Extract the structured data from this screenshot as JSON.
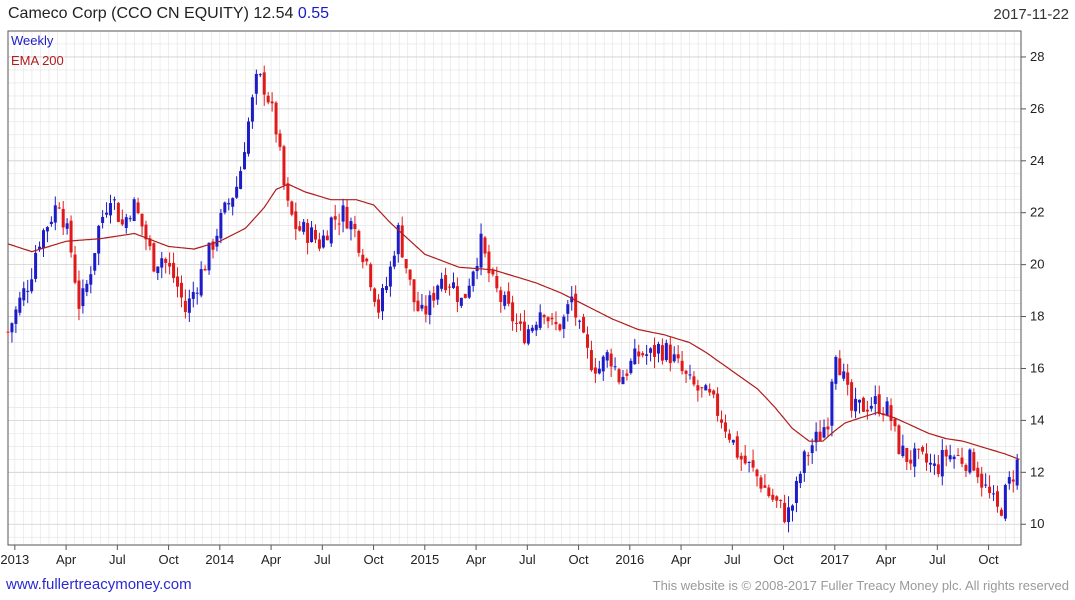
{
  "header": {
    "title": "Cameco Corp (CCO CN EQUITY)",
    "price": "12.54",
    "change": "0.55",
    "date": "2017-11-22"
  },
  "footer": {
    "website": "www.fullertreacymoney.com",
    "copyright": "This website is © 2008-2017 Fuller Treacy Money plc. All rights reserved"
  },
  "colors": {
    "up": "#1c1cc8",
    "down": "#e01a1a",
    "ema": "#b01c1c",
    "grid": "#e2e2e2",
    "frame": "#555555"
  },
  "chart_data": {
    "type": "candlestick",
    "legend": [
      {
        "label": "Weekly",
        "color": "#1c1cc8"
      },
      {
        "label": "EMA 200",
        "color": "#b01c1c"
      }
    ],
    "ylim": [
      9.2,
      29.0
    ],
    "y_ticks": [
      10,
      12,
      14,
      16,
      18,
      20,
      22,
      24,
      26,
      28
    ],
    "x_ticks": [
      {
        "label": "2013",
        "month": 0
      },
      {
        "label": "Apr",
        "month": 3
      },
      {
        "label": "Jul",
        "month": 6
      },
      {
        "label": "Oct",
        "month": 9
      },
      {
        "label": "2014",
        "month": 12
      },
      {
        "label": "Apr",
        "month": 15
      },
      {
        "label": "Jul",
        "month": 18
      },
      {
        "label": "Oct",
        "month": 21
      },
      {
        "label": "2015",
        "month": 24
      },
      {
        "label": "Apr",
        "month": 27
      },
      {
        "label": "Jul",
        "month": 30
      },
      {
        "label": "Oct",
        "month": 33
      },
      {
        "label": "2016",
        "month": 36
      },
      {
        "label": "Apr",
        "month": 39
      },
      {
        "label": "Jul",
        "month": 42
      },
      {
        "label": "Oct",
        "month": 45
      },
      {
        "label": "2017",
        "month": 48
      },
      {
        "label": "Apr",
        "month": 51
      },
      {
        "label": "Jul",
        "month": 54
      },
      {
        "label": "Oct",
        "month": 57
      }
    ],
    "x_range_months": [
      -0.4,
      58.9
    ],
    "close_keypoints": [
      [
        -0.4,
        17.4
      ],
      [
        0.3,
        18.6
      ],
      [
        0.9,
        19.5
      ],
      [
        1.3,
        20.8
      ],
      [
        2.0,
        21.7
      ],
      [
        2.6,
        22.5
      ],
      [
        3.3,
        20.5
      ],
      [
        3.8,
        18.3
      ],
      [
        4.3,
        19.4
      ],
      [
        4.9,
        21.4
      ],
      [
        5.6,
        22.8
      ],
      [
        6.3,
        21.5
      ],
      [
        6.9,
        22.4
      ],
      [
        7.5,
        21.4
      ],
      [
        8.1,
        20.1
      ],
      [
        8.6,
        20.3
      ],
      [
        9.4,
        19.4
      ],
      [
        10.0,
        18.2
      ],
      [
        10.6,
        19.2
      ],
      [
        11.3,
        20.3
      ],
      [
        12.0,
        21.6
      ],
      [
        12.6,
        22.5
      ],
      [
        13.1,
        23.2
      ],
      [
        13.5,
        24.9
      ],
      [
        14.2,
        27.2
      ],
      [
        14.7,
        26.8
      ],
      [
        15.3,
        25.2
      ],
      [
        15.9,
        22.3
      ],
      [
        16.5,
        21.4
      ],
      [
        17.3,
        21.2
      ],
      [
        17.9,
        20.8
      ],
      [
        18.5,
        21.7
      ],
      [
        19.3,
        22.0
      ],
      [
        19.9,
        21.3
      ],
      [
        20.6,
        20.1
      ],
      [
        21.3,
        18.3
      ],
      [
        21.9,
        19.5
      ],
      [
        22.4,
        21.4
      ],
      [
        22.8,
        20.3
      ],
      [
        23.3,
        18.7
      ],
      [
        23.8,
        18.0
      ],
      [
        24.3,
        18.5
      ],
      [
        24.9,
        19.6
      ],
      [
        25.6,
        19.3
      ],
      [
        26.2,
        18.5
      ],
      [
        26.8,
        19.9
      ],
      [
        27.3,
        20.8
      ],
      [
        27.9,
        19.3
      ],
      [
        28.5,
        18.6
      ],
      [
        29.1,
        18.0
      ],
      [
        29.7,
        17.3
      ],
      [
        30.3,
        17.7
      ],
      [
        30.9,
        18.5
      ],
      [
        31.5,
        17.5
      ],
      [
        32.1,
        17.8
      ],
      [
        32.6,
        18.7
      ],
      [
        33.1,
        17.3
      ],
      [
        33.6,
        16.4
      ],
      [
        34.2,
        16.0
      ],
      [
        34.8,
        16.6
      ],
      [
        35.4,
        15.6
      ],
      [
        36.0,
        16.1
      ],
      [
        36.6,
        16.6
      ],
      [
        37.2,
        16.5
      ],
      [
        37.7,
        16.8
      ],
      [
        38.3,
        16.6
      ],
      [
        38.9,
        16.0
      ],
      [
        39.5,
        15.4
      ],
      [
        40.1,
        15.1
      ],
      [
        40.7,
        14.8
      ],
      [
        41.3,
        14.2
      ],
      [
        41.9,
        13.4
      ],
      [
        42.4,
        12.6
      ],
      [
        43.0,
        12.2
      ],
      [
        43.6,
        11.7
      ],
      [
        44.2,
        11.1
      ],
      [
        44.7,
        10.7
      ],
      [
        45.2,
        10.3
      ],
      [
        45.6,
        10.9
      ],
      [
        46.1,
        12.3
      ],
      [
        46.6,
        13.0
      ],
      [
        47.1,
        13.4
      ],
      [
        47.6,
        14.1
      ],
      [
        48.0,
        17.0
      ],
      [
        48.5,
        15.6
      ],
      [
        49.0,
        14.3
      ],
      [
        49.5,
        14.5
      ],
      [
        50.1,
        14.7
      ],
      [
        50.7,
        14.6
      ],
      [
        51.2,
        14.3
      ],
      [
        51.6,
        13.2
      ],
      [
        52.1,
        12.6
      ],
      [
        52.7,
        12.5
      ],
      [
        53.3,
        12.4
      ],
      [
        53.9,
        12.1
      ],
      [
        54.5,
        12.7
      ],
      [
        55.1,
        12.6
      ],
      [
        55.6,
        12.5
      ],
      [
        56.2,
        12.4
      ],
      [
        56.7,
        11.5
      ],
      [
        57.2,
        10.9
      ],
      [
        57.6,
        10.4
      ],
      [
        58.0,
        11.2
      ],
      [
        58.4,
        11.9
      ],
      [
        58.8,
        12.54
      ]
    ],
    "ema_keypoints": [
      [
        -0.4,
        20.8
      ],
      [
        1.0,
        20.5
      ],
      [
        3.0,
        20.9
      ],
      [
        5.0,
        21.0
      ],
      [
        7.0,
        21.2
      ],
      [
        9.0,
        20.7
      ],
      [
        10.5,
        20.6
      ],
      [
        12.0,
        20.9
      ],
      [
        13.5,
        21.4
      ],
      [
        14.6,
        22.2
      ],
      [
        15.3,
        22.9
      ],
      [
        16.0,
        23.1
      ],
      [
        17.0,
        22.8
      ],
      [
        18.5,
        22.5
      ],
      [
        20.0,
        22.5
      ],
      [
        21.0,
        22.3
      ],
      [
        22.0,
        21.6
      ],
      [
        23.0,
        21.0
      ],
      [
        24.0,
        20.4
      ],
      [
        26.0,
        19.9
      ],
      [
        28.0,
        19.8
      ],
      [
        29.0,
        19.6
      ],
      [
        30.5,
        19.3
      ],
      [
        32.0,
        18.9
      ],
      [
        33.5,
        18.4
      ],
      [
        35.0,
        17.9
      ],
      [
        36.5,
        17.5
      ],
      [
        38.0,
        17.3
      ],
      [
        39.5,
        17.0
      ],
      [
        40.5,
        16.6
      ],
      [
        42.0,
        15.9
      ],
      [
        43.5,
        15.2
      ],
      [
        44.5,
        14.5
      ],
      [
        45.5,
        13.7
      ],
      [
        46.5,
        13.2
      ],
      [
        47.3,
        13.2
      ],
      [
        48.0,
        13.6
      ],
      [
        48.6,
        13.9
      ],
      [
        49.5,
        14.1
      ],
      [
        50.5,
        14.3
      ],
      [
        51.5,
        14.1
      ],
      [
        52.5,
        13.8
      ],
      [
        53.5,
        13.5
      ],
      [
        54.5,
        13.3
      ],
      [
        55.5,
        13.2
      ],
      [
        56.5,
        13.0
      ],
      [
        57.5,
        12.8
      ],
      [
        58.0,
        12.7
      ],
      [
        58.8,
        12.5
      ]
    ]
  }
}
